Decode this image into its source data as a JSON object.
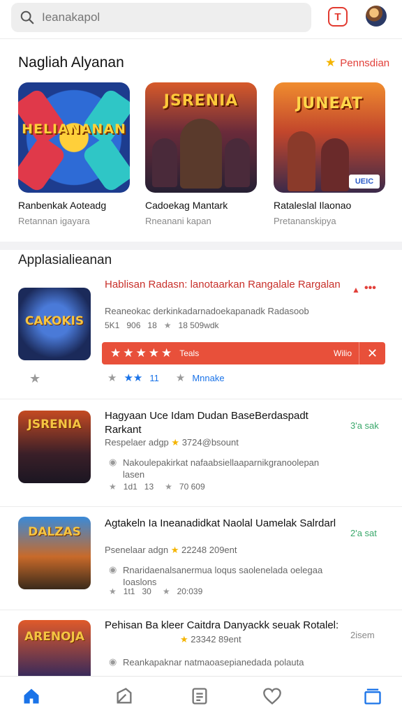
{
  "search": {
    "placeholder": "Ieanakapol",
    "icon": "search-icon"
  },
  "header": {
    "badge_letter": "T"
  },
  "featured": {
    "title": "Nagliah Alyanan",
    "link_label": "Pennsdian",
    "cards": [
      {
        "art_text": "HELIANANAN",
        "name": "Ranbenkak Aoteadg",
        "subtitle": "Retannan igayara"
      },
      {
        "art_text": "JSRENIA",
        "name": "Cadoekag Mantark",
        "subtitle": "Rneanani kapan"
      },
      {
        "art_text": "JUNEAT",
        "name": "Rataleslal Ilaonao",
        "subtitle": "Pretananskipya"
      }
    ]
  },
  "list": {
    "title": "Applasialieanan",
    "apps": [
      {
        "art_text": "CAKOKIS",
        "title": "Hablisan Radasn: lanotaarkan Rangalale Rargalan",
        "subtitle": "Reaneokac derkinkadarnadoekapanadk Radasoob",
        "stats": [
          "5K1",
          "906",
          "18",
          "18 509wdk"
        ],
        "rating_bar": {
          "stars": "★★★★★",
          "label": "Teals",
          "action": "Wilio"
        },
        "extra_count": "11",
        "extra_label": "Mnnake"
      },
      {
        "art_text": "JSRENIA",
        "title": "Hagyaan Uce Idam Dudan BaseBerdaspadt Rarkant",
        "subtitle": "Respelaer adgp",
        "subtitle_extra": "3724@bsount",
        "desc": "Nakoulepakirkat nafaabsiellaaparnikgranoolepan lasen",
        "stats": [
          "1d1",
          "13",
          "70 609"
        ],
        "size": "3'a sak"
      },
      {
        "art_text": "DALZAS",
        "title": "Agtakeln Ia Ineanadidkat Naolal Uamelak Salrdarl",
        "subtitle": "Psenelaar adgn",
        "subtitle_extra": "22248 209ent",
        "desc": "Rnaridaenalsanermua loqus saolenelada oelegaa Ioaslons",
        "stats": [
          "1t1",
          "30",
          "20:039"
        ],
        "size": "2'a sat"
      },
      {
        "art_text": "ARENOJA",
        "title": "Pehisan Ba kleer Caitdra Danyackk seuak Rotalel:",
        "subtitle_extra": "23342 89ent",
        "desc": "Reankapaknar natmaoasepianedada polauta",
        "size": "2isem"
      }
    ]
  },
  "nav": [
    "home-icon",
    "apps-icon",
    "updates-icon",
    "wishlist-icon",
    "library-icon"
  ],
  "colors": {
    "accent": "#e2403a",
    "star": "#f4b400",
    "size_green": "#3aa86b",
    "nav_blue": "#1a73e8"
  }
}
